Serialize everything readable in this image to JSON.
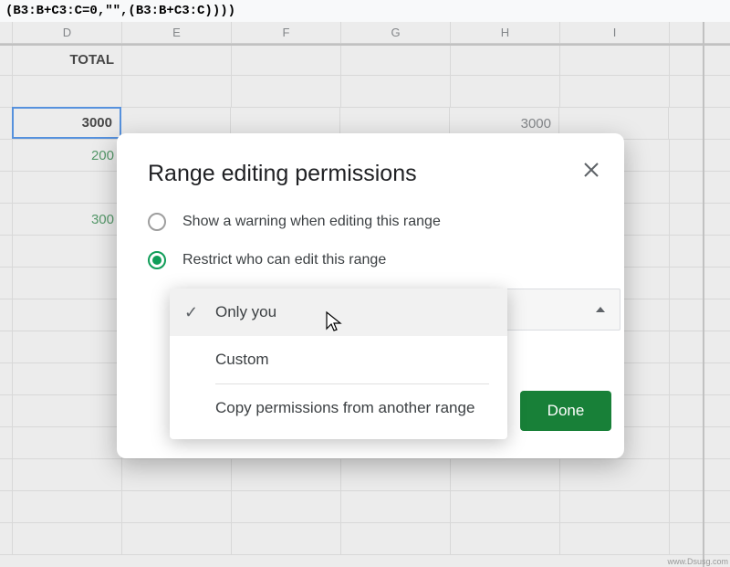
{
  "formula_bar": "(B3:B+C3:C=0,\"\",(B3:B+C3:C))))",
  "columns": {
    "D": "D",
    "E": "E",
    "F": "F",
    "G": "G",
    "H": "H",
    "I": "I"
  },
  "header_row": {
    "D": "TOTAL"
  },
  "cells": {
    "r3_D": "3000",
    "r3_H": "3000",
    "r4_D": "200",
    "r6_D": "300"
  },
  "modal": {
    "title": "Range editing permissions",
    "opt_warning": "Show a warning when editing this range",
    "opt_restrict": "Restrict who can edit this range",
    "done": "Done"
  },
  "dropdown": {
    "only_you": "Only you",
    "custom": "Custom",
    "copy_from": "Copy permissions from another range"
  },
  "watermark": "www.Dsusg.com"
}
